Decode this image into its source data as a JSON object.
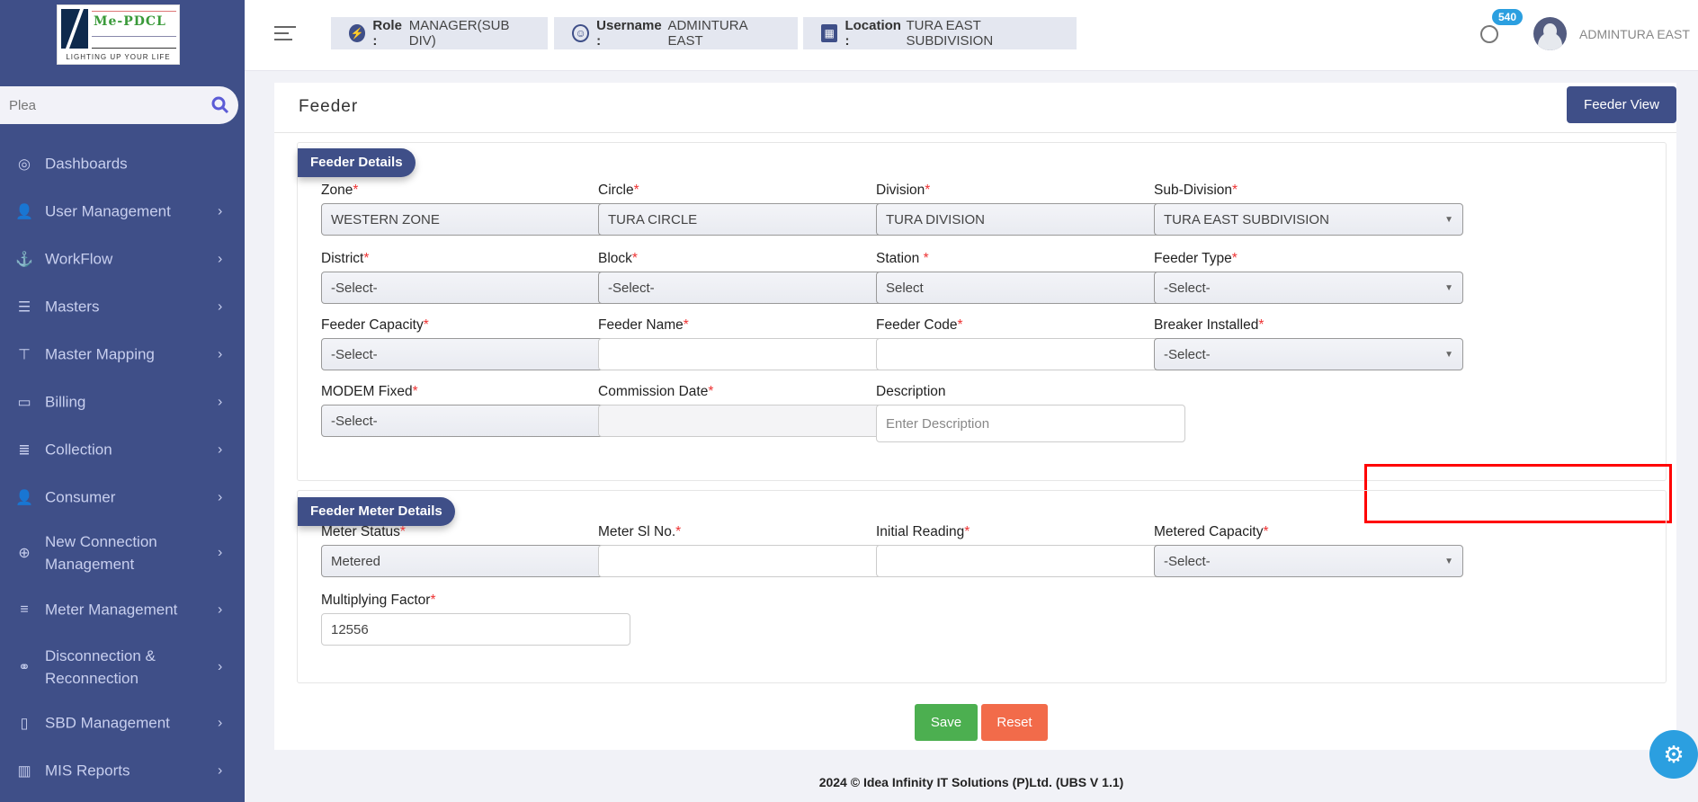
{
  "logo": {
    "brand": "Me-PDCL",
    "tagline": "LIGHTING UP YOUR LIFE"
  },
  "search": {
    "placeholder": "Plea"
  },
  "sidebar": {
    "items": [
      {
        "label": "Dashboards",
        "icon": "◎",
        "chevron": false
      },
      {
        "label": "User Management",
        "icon": "👤",
        "chevron": true
      },
      {
        "label": "WorkFlow",
        "icon": "⚓",
        "chevron": true
      },
      {
        "label": "Masters",
        "icon": "☰",
        "chevron": true
      },
      {
        "label": "Master Mapping",
        "icon": "⊤",
        "chevron": true
      },
      {
        "label": "Billing",
        "icon": "▭",
        "chevron": true
      },
      {
        "label": "Collection",
        "icon": "≣",
        "chevron": true
      },
      {
        "label": "Consumer",
        "icon": "👤",
        "chevron": true
      },
      {
        "label": "New Connection Management",
        "icon": "⊕",
        "chevron": true
      },
      {
        "label": "Meter Management",
        "icon": "≡",
        "chevron": true
      },
      {
        "label": "Disconnection & Reconnection",
        "icon": "⚭",
        "chevron": true
      },
      {
        "label": "SBD Management",
        "icon": "▯",
        "chevron": true
      },
      {
        "label": "MIS Reports",
        "icon": "▥",
        "chevron": true
      }
    ]
  },
  "header": {
    "role_label": "Role :",
    "role": "MANAGER(SUB DIV)",
    "username_label": "Username :",
    "username": "ADMINTURA EAST",
    "location_label": "Location :",
    "location": "TURA EAST SUBDIVISION",
    "notification_count": "540",
    "user_name": "ADMINTURA EAST"
  },
  "page": {
    "title": "Feeder",
    "feeder_view": "Feeder View"
  },
  "feeder_details": {
    "title": "Feeder Details",
    "fields": [
      {
        "label": "Zone",
        "req": "*",
        "value": "WESTERN ZONE",
        "type": "sel"
      },
      {
        "label": "Circle",
        "req": "*",
        "value": "TURA CIRCLE",
        "type": "sel"
      },
      {
        "label": "Division",
        "req": "*",
        "value": "TURA DIVISION",
        "type": "sel"
      },
      {
        "label": "Sub-Division",
        "req": "*",
        "value": "TURA EAST SUBDIVISION",
        "type": "sel"
      },
      {
        "label": "District",
        "req": "*",
        "value": "-Select-",
        "type": "sel"
      },
      {
        "label": "Block",
        "req": "*",
        "value": "-Select-",
        "type": "sel"
      },
      {
        "label": "Station ",
        "req": "*",
        "value": "Select",
        "type": "sel"
      },
      {
        "label": "Feeder Type",
        "req": "*",
        "value": "-Select-",
        "type": "sel"
      },
      {
        "label": "Feeder Capacity",
        "req": "*",
        "value": "-Select-",
        "type": "sel"
      },
      {
        "label": "Feeder Name",
        "req": "*",
        "value": "",
        "type": "txt"
      },
      {
        "label": "Feeder Code",
        "req": "*",
        "value": "",
        "type": "txt"
      },
      {
        "label": "Breaker Installed",
        "req": "*",
        "value": "-Select-",
        "type": "sel"
      },
      {
        "label": "MODEM Fixed",
        "req": "*",
        "value": "-Select-",
        "type": "sel"
      },
      {
        "label": "Commission Date",
        "req": "*",
        "value": "",
        "type": "dis"
      },
      {
        "label": "Description",
        "req": "",
        "value": "Enter Description",
        "type": "area"
      }
    ]
  },
  "meter_details": {
    "title": "Feeder Meter Details",
    "fields": [
      {
        "label": "Meter Status",
        "req": "*",
        "value": "Metered",
        "type": "sel"
      },
      {
        "label": "Meter Sl No.",
        "req": "*",
        "value": "",
        "type": "txt"
      },
      {
        "label": "Initial Reading",
        "req": "*",
        "value": "",
        "type": "txt"
      },
      {
        "label": "Metered Capacity",
        "req": "*",
        "value": "-Select-",
        "type": "sel"
      },
      {
        "label": "Multiplying Factor",
        "req": "*",
        "value": "12556",
        "type": "txt"
      }
    ]
  },
  "actions": {
    "save": "Save",
    "reset": "Reset",
    "save_color": "#4caf50",
    "reset_color": "#f26b4a"
  },
  "footer": "2024 © Idea Infinity IT Solutions (P)Ltd. (UBS V 1.1)"
}
